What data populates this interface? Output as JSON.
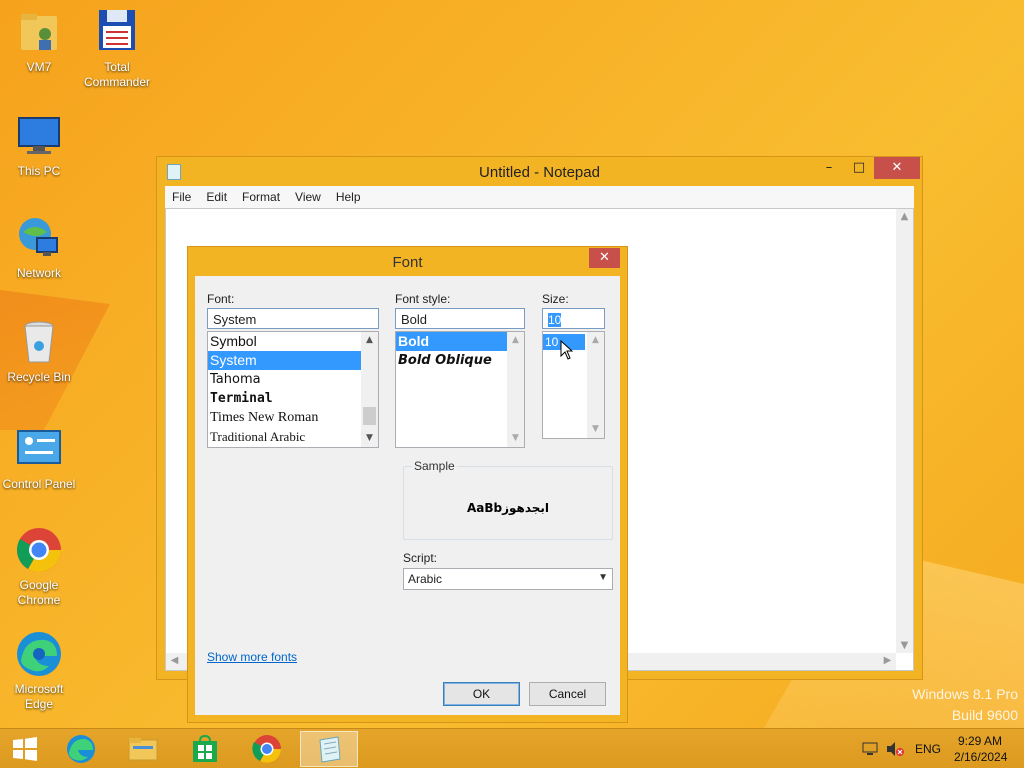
{
  "desktop": {
    "icons": [
      {
        "label": "VM7"
      },
      {
        "label": "Total Commander"
      },
      {
        "label": "This PC"
      },
      {
        "label": "Network"
      },
      {
        "label": "Recycle Bin"
      },
      {
        "label": "Control Panel"
      },
      {
        "label": "Google Chrome"
      },
      {
        "label": "Microsoft Edge"
      }
    ],
    "watermark_line1": "Windows 8.1 Pro",
    "watermark_line2": "Build 9600"
  },
  "notepad": {
    "title": "Untitled - Notepad",
    "menu": [
      "File",
      "Edit",
      "Format",
      "View",
      "Help"
    ],
    "minimize": "–",
    "maximize": "□",
    "close": "✕"
  },
  "font_dialog": {
    "title": "Font",
    "close": "✕",
    "font_label": "Font:",
    "font_value": "System",
    "font_list": [
      "Symbol",
      "System",
      "Tahoma",
      "Terminal",
      "Times New Roman",
      "Traditional Arabic"
    ],
    "font_selected": "System",
    "style_label": "Font style:",
    "style_value": "Bold",
    "style_list": [
      "Bold",
      "Bold Oblique"
    ],
    "size_label": "Size:",
    "size_value": "10",
    "size_list": [
      "10"
    ],
    "sample_label": "Sample",
    "sample_text": "AaBbابجدهوز",
    "script_label": "Script:",
    "script_value": "Arabic",
    "show_more": "Show more fonts",
    "ok": "OK",
    "cancel": "Cancel"
  },
  "taskbar": {
    "language": "ENG",
    "time": "9:29 AM",
    "date": "2/16/2024"
  },
  "colors": {
    "accent": "#f3b424",
    "selection": "#3399ff",
    "close": "#c7504a"
  }
}
